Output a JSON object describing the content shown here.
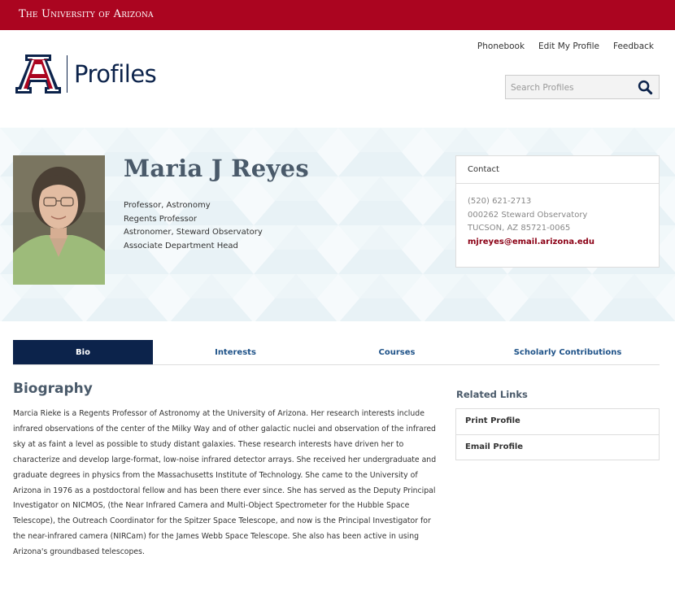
{
  "header": {
    "university": "The University of Arizona",
    "brand_color": "#ab0520",
    "navy": "#0c234b"
  },
  "util_nav": [
    "Phonebook",
    "Edit My Profile",
    "Feedback"
  ],
  "logo": {
    "title": "Profiles"
  },
  "search": {
    "placeholder": "Search Profiles",
    "icon": "search-icon"
  },
  "profile": {
    "name": "Maria J Reyes",
    "titles": [
      "Professor, Astronomy",
      "Regents Professor",
      "Astronomer, Steward Observatory",
      "Associate Department Head"
    ]
  },
  "contact": {
    "heading": "Contact",
    "phone": "(520) 621-2713",
    "address_line1": "000262 Steward Observatory",
    "address_line2": "TUCSON, AZ 85721-0065",
    "email": "mjreyes@email.arizona.edu"
  },
  "tabs": [
    {
      "label": "Bio",
      "active": true
    },
    {
      "label": "Interests",
      "active": false
    },
    {
      "label": "Courses",
      "active": false
    },
    {
      "label": "Scholarly Contributions",
      "active": false
    }
  ],
  "bio": {
    "heading": "Biography",
    "text": "Marcia Rieke is a Regents Professor of Astronomy at the University of  Arizona.  Her research interests include infrared observations of the center of the Milky Way and of other galactic nuclei and observation of the infrared sky at as faint a level as possible to study distant galaxies. These research interests have driven her to characterize and develop large-format, low-noise infrared detector arrays. She received her undergraduate and graduate degrees in physics from the Massachusetts Institute of Technology. She came to the University of Arizona in 1976 as a postdoctoral fellow and has been there ever since.   She has served as the Deputy Principal Investigator on NICMOS, (the Near Infrared Camera and Multi-Object Spectrometer for the Hubble Space Telescope), the Outreach Coordinator for the Spitzer Space Telescope, and now is the Principal Investigator for the near-infrared camera (NIRCam) for the James Webb Space Telescope.  She also has been active in using Arizona's groundbased telescopes."
  },
  "related": {
    "heading": "Related Links",
    "links": [
      "Print Profile",
      "Email Profile"
    ]
  }
}
